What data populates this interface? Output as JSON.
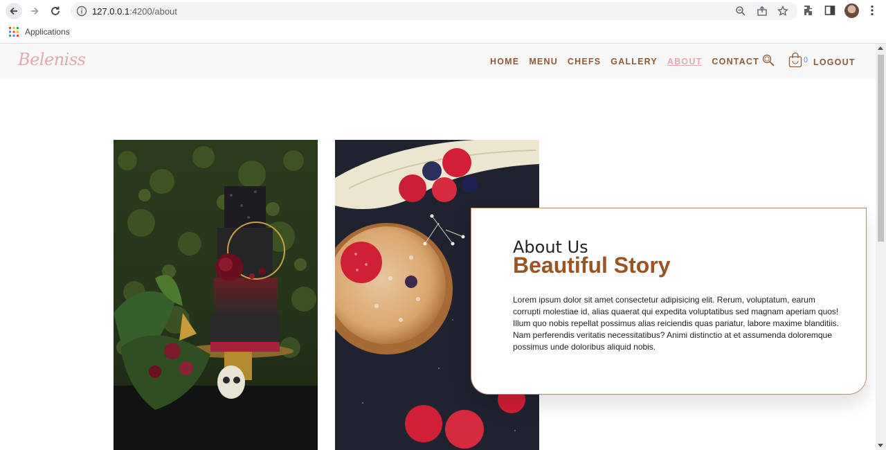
{
  "browser": {
    "url_host": "127.0.0.1",
    "url_path": ":4200/about",
    "bookmarks": [
      {
        "label": "Applications"
      }
    ]
  },
  "site": {
    "logo": "Beleniss",
    "menu": [
      {
        "label": "HOME",
        "active": false
      },
      {
        "label": "MENU",
        "active": false
      },
      {
        "label": "CHEFS",
        "active": false
      },
      {
        "label": "GALLERY",
        "active": false
      },
      {
        "label": "ABOUT",
        "active": true
      },
      {
        "label": "CONTACT",
        "active": false
      }
    ],
    "cart_count": "0",
    "logout_label": "LOGOUT",
    "colors": {
      "accent": "#9a5322",
      "menu": "#8a5a3a",
      "logo": "#e3a8b0"
    }
  },
  "about": {
    "eyebrow": "About Us",
    "title": "Beautiful Story",
    "body": "Lorem ipsum dolor sit amet consectetur adipisicing elit. Rerum, voluptatum, earum corrupti molestiae id, alias quaerat qui expedita voluptatibus sed magnam aperiam quos! Illum quo nobis repellat possimus alias reiciendis quas pariatur, labore maxime blanditiis. Nam perferendis veritatis necessitatibus? Animi distinctio at et assumenda doloremque possimus unde doloribus aliquid nobis."
  }
}
